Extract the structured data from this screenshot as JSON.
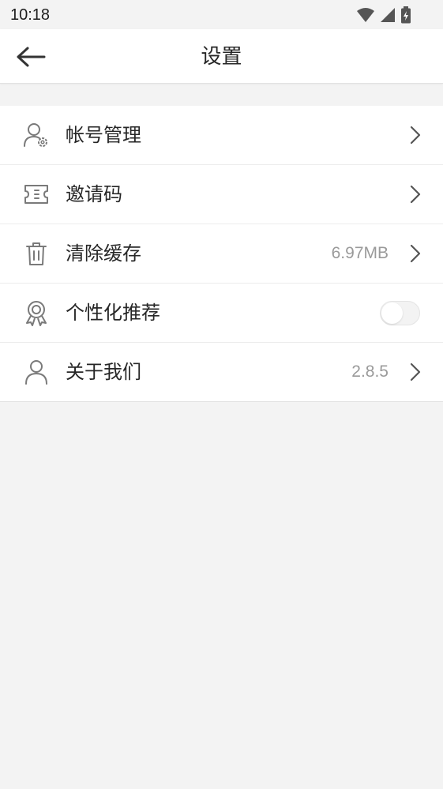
{
  "status_bar": {
    "time": "10:18",
    "icons": [
      "wifi-icon",
      "cellular-signal-icon",
      "battery-charging-icon"
    ]
  },
  "header": {
    "title": "设置",
    "back_icon": "arrow-left-icon"
  },
  "settings": {
    "items": [
      {
        "label": "帐号管理",
        "icon": "user-gear-icon",
        "value": "",
        "control": "chevron"
      },
      {
        "label": "邀请码",
        "icon": "ticket-icon",
        "value": "",
        "control": "chevron"
      },
      {
        "label": "清除缓存",
        "icon": "trash-icon",
        "value": "6.97MB",
        "control": "chevron"
      },
      {
        "label": "个性化推荐",
        "icon": "award-ribbon-icon",
        "value": "",
        "control": "toggle",
        "toggle_on": false
      },
      {
        "label": "关于我们",
        "icon": "user-icon",
        "value": "2.8.5",
        "control": "chevron"
      }
    ]
  },
  "colors": {
    "background": "#f3f3f3",
    "surface": "#ffffff",
    "text_primary": "#262626",
    "text_secondary": "#9a9a9a",
    "icon": "#7a7a7a",
    "divider": "#ececec"
  }
}
